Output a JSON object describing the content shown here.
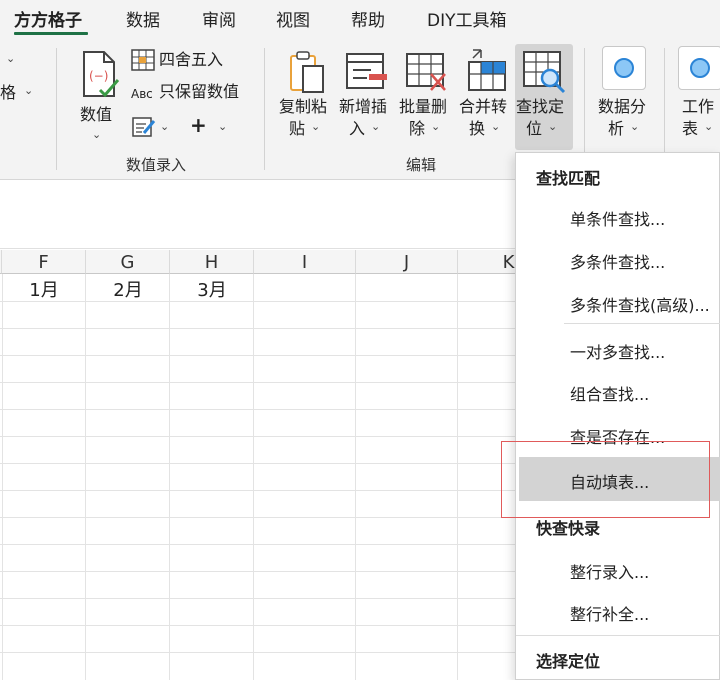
{
  "tabs": [
    "方方格子",
    "数据",
    "审阅",
    "视图",
    "帮助",
    "DIY工具箱"
  ],
  "active_tab": "方方格子",
  "ribbon": {
    "left_partial": {
      "row2": "格"
    },
    "number_group": {
      "big_button": "数值",
      "round": "四舍五入",
      "keep_values": "只保留数值",
      "plus": "+",
      "label": "数值录入"
    },
    "edit_group": {
      "copy_paste": [
        "复制粘",
        "贴"
      ],
      "add_insert": [
        "新增插",
        "入"
      ],
      "batch_delete": [
        "批量删",
        "除"
      ],
      "merge_convert": [
        "合并转",
        "换"
      ],
      "find_locate": [
        "查找定",
        "位"
      ],
      "label": "编辑"
    },
    "data_analysis": [
      "数据分",
      "析"
    ],
    "worksheet": [
      "工作",
      "表"
    ]
  },
  "grid": {
    "columns": [
      "F",
      "G",
      "H",
      "I",
      "J",
      "K"
    ],
    "row1": [
      "1月",
      "2月",
      "3月"
    ]
  },
  "dropdown": {
    "section1": "查找匹配",
    "items1": [
      "单条件查找...",
      "多条件查找...",
      "多条件查找(高级)..."
    ],
    "items2": [
      "一对多查找...",
      "组合查找...",
      "查是否存在...",
      "自动填表..."
    ],
    "section2": "快查快录",
    "items3": [
      "整行录入...",
      "整行补全..."
    ],
    "section3": "选择定位",
    "highlighted": "自动填表..."
  },
  "colors": {
    "accent": "#1e7145",
    "highlight_box": "#e05a5a",
    "menu_highlight": "#d3d3d3"
  }
}
